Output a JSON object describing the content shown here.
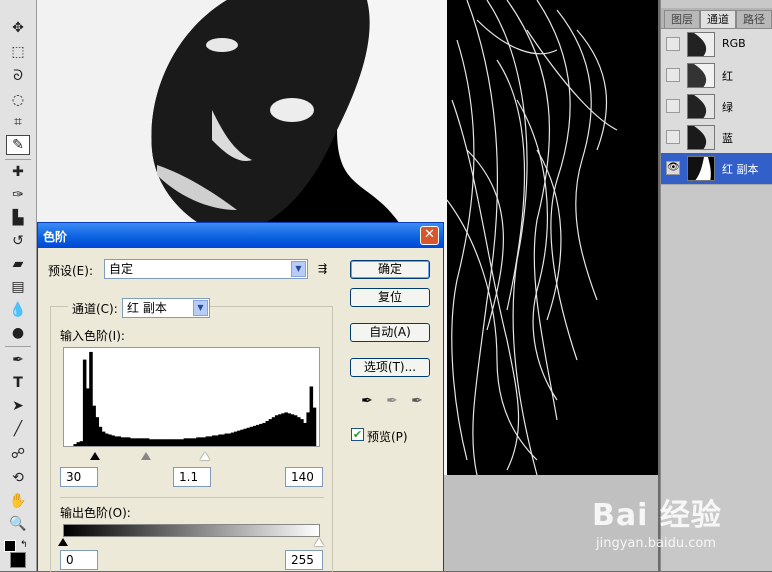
{
  "toolbar": {
    "tools": [
      "move-icon",
      "marquee-icon",
      "lasso-icon",
      "quick-select-icon",
      "crop-icon",
      "eyedropper-icon",
      "heal-icon",
      "brush-icon",
      "stamp-icon",
      "history-brush-icon",
      "eraser-icon",
      "gradient-icon",
      "blur-icon",
      "dodge-icon",
      "pen-icon",
      "type-icon",
      "path-select-icon",
      "line-icon",
      "3d-icon",
      "rotate-view-icon",
      "hand-icon",
      "zoom-icon"
    ]
  },
  "panel": {
    "tabs": [
      "图层",
      "通道",
      "路径"
    ],
    "active_tab": 1,
    "channels": [
      {
        "name": "RGB",
        "visible": false,
        "selected": false
      },
      {
        "name": "红",
        "visible": false,
        "selected": false
      },
      {
        "name": "绿",
        "visible": false,
        "selected": false
      },
      {
        "name": "蓝",
        "visible": false,
        "selected": false
      },
      {
        "name": "红 副本",
        "visible": true,
        "selected": true
      }
    ]
  },
  "dialog": {
    "title": "色阶",
    "preset_label": "预设(E):",
    "preset_value": "自定",
    "channel_label": "通道(C):",
    "channel_value": "红 副本",
    "input_levels_label": "输入色阶(I):",
    "input_black": "30",
    "input_gamma": "1.1",
    "input_white": "140",
    "output_levels_label": "输出色阶(O):",
    "output_black": "0",
    "output_white": "255",
    "buttons": {
      "ok": "确定",
      "reset": "复位",
      "auto": "自动(A)",
      "options": "选项(T)..."
    },
    "preview_label": "预览(P)",
    "preview_checked": true
  },
  "histogram": [
    0,
    0,
    0,
    2,
    4,
    5,
    90,
    60,
    98,
    42,
    30,
    20,
    15,
    13,
    12,
    11,
    10,
    10,
    9,
    9,
    9,
    8,
    8,
    8,
    8,
    8,
    8,
    7,
    7,
    7,
    7,
    7,
    7,
    7,
    7,
    7,
    7,
    7,
    8,
    8,
    8,
    8,
    9,
    9,
    9,
    10,
    10,
    11,
    11,
    12,
    12,
    13,
    13,
    14,
    15,
    16,
    17,
    18,
    19,
    20,
    21,
    22,
    23,
    24,
    26,
    28,
    30,
    32,
    33,
    34,
    35,
    34,
    33,
    32,
    30,
    28,
    24,
    35,
    62,
    40,
    0
  ],
  "watermark": {
    "logo": "Bai 经验",
    "url": "jingyan.baidu.com"
  },
  "colors": {
    "title_bar": "#0a5fe0",
    "selected_channel": "#3260c8",
    "dialog_bg": "#ece9d8"
  }
}
